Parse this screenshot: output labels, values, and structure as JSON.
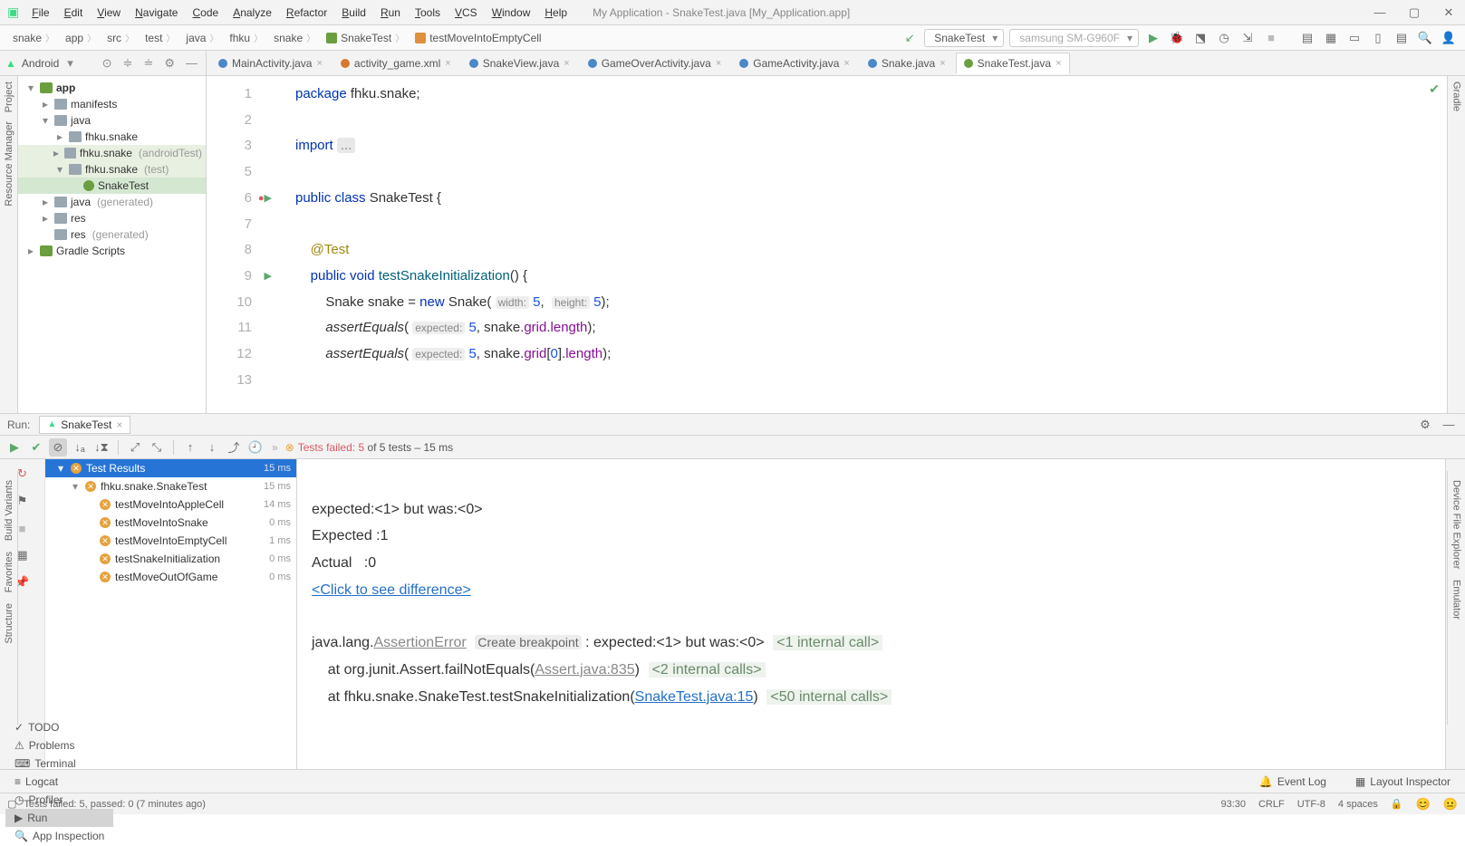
{
  "window": {
    "menu": [
      "File",
      "Edit",
      "View",
      "Navigate",
      "Code",
      "Analyze",
      "Refactor",
      "Build",
      "Run",
      "Tools",
      "VCS",
      "Window",
      "Help"
    ],
    "title": "My Application - SnakeTest.java [My_Application.app]"
  },
  "breadcrumb": [
    "snake",
    "app",
    "src",
    "test",
    "java",
    "fhku",
    "snake",
    "SnakeTest",
    "testMoveIntoEmptyCell"
  ],
  "toolbar": {
    "config": "SnakeTest",
    "device": "samsung SM-G960F"
  },
  "project": {
    "view_label": "Android",
    "tree": [
      {
        "d": 0,
        "arr": "▾",
        "ico": "mod",
        "txt": "app",
        "bold": true
      },
      {
        "d": 1,
        "arr": "▸",
        "ico": "fldr",
        "txt": "manifests"
      },
      {
        "d": 1,
        "arr": "▾",
        "ico": "fldr",
        "txt": "java"
      },
      {
        "d": 2,
        "arr": "▸",
        "ico": "pkg",
        "txt": "fhku.snake"
      },
      {
        "d": 2,
        "arr": "▸",
        "ico": "pkg",
        "txt": "fhku.snake",
        "note": "(androidTest)",
        "hi": true
      },
      {
        "d": 2,
        "arr": "▾",
        "ico": "pkg",
        "txt": "fhku.snake",
        "note": "(test)",
        "hi": true
      },
      {
        "d": 3,
        "arr": "",
        "ico": "cls",
        "txt": "SnakeTest",
        "sel": true
      },
      {
        "d": 1,
        "arr": "▸",
        "ico": "fldr",
        "txt": "java",
        "note": "(generated)"
      },
      {
        "d": 1,
        "arr": "▸",
        "ico": "fldr",
        "txt": "res"
      },
      {
        "d": 1,
        "arr": "",
        "ico": "fldr",
        "txt": "res",
        "note": "(generated)"
      },
      {
        "d": 0,
        "arr": "▸",
        "ico": "mod",
        "txt": "Gradle Scripts"
      }
    ]
  },
  "tabs": [
    {
      "name": "MainActivity.java",
      "ico": "c"
    },
    {
      "name": "activity_game.xml",
      "ico": "x"
    },
    {
      "name": "SnakeView.java",
      "ico": "c"
    },
    {
      "name": "GameOverActivity.java",
      "ico": "c"
    },
    {
      "name": "GameActivity.java",
      "ico": "c"
    },
    {
      "name": "Snake.java",
      "ico": "c"
    },
    {
      "name": "SnakeTest.java",
      "ico": "g",
      "active": true
    }
  ],
  "editor": {
    "lines": [
      "<span class='kw'>package</span> fhku.snake;",
      "",
      "<span class='kw'>import</span> <span class='fold'>...</span>",
      "",
      "<span class='kw'>public class</span> SnakeTest {",
      "",
      "    <span class='ann'>@Test</span>",
      "    <span class='kw'>public void</span> <span style='color:#00627a'>testSnakeInitialization</span>() {",
      "        Snake snake = <span class='kw'>new</span> Snake( <span class='hint'>width:</span> <span class='num'>5</span>,  <span class='hint'>height:</span> <span class='num'>5</span>);",
      "        <span class='fn'>assertEquals</span>( <span class='hint'>expected:</span> <span class='num'>5</span>, snake.<span class='fld'>grid</span>.<span class='fld'>length</span>);",
      "        <span class='fn'>assertEquals</span>( <span class='hint'>expected:</span> <span class='num'>5</span>, snake.<span class='fld'>grid</span>[<span class='num'>0</span>].<span class='fld'>length</span>);",
      ""
    ],
    "nums": [
      "1",
      "2",
      "3",
      "5",
      "6",
      "7",
      "8",
      "9",
      "10",
      "11",
      "12",
      "13"
    ],
    "gutter_marks": {
      "4": "rund",
      "7": "run"
    }
  },
  "run": {
    "label": "Run:",
    "tab": "SnakeTest",
    "summary_pre": "Tests failed: 5",
    "summary_post": " of 5 tests – 15 ms",
    "tree": [
      {
        "d": 0,
        "arr": "▾",
        "nm": "Test Results",
        "tm": "15 ms",
        "sel": true
      },
      {
        "d": 1,
        "arr": "▾",
        "nm": "fhku.snake.SnakeTest",
        "tm": "15 ms"
      },
      {
        "d": 2,
        "arr": "",
        "nm": "testMoveIntoAppleCell",
        "tm": "14 ms"
      },
      {
        "d": 2,
        "arr": "",
        "nm": "testMoveIntoSnake",
        "tm": "0 ms"
      },
      {
        "d": 2,
        "arr": "",
        "nm": "testMoveIntoEmptyCell",
        "tm": "1 ms"
      },
      {
        "d": 2,
        "arr": "",
        "nm": "testSnakeInitialization",
        "tm": "0 ms"
      },
      {
        "d": 2,
        "arr": "",
        "nm": "testMoveOutOfGame",
        "tm": "0 ms"
      }
    ],
    "console": {
      "l1": "expected:<1> but was:<0>",
      "l2": "Expected :1",
      "l3": "Actual   :0",
      "diff": "<Click to see difference>",
      "err1a": "java.lang.",
      "err1b": "AssertionError",
      "bp": "Create breakpoint",
      "err1c": " : expected:<1> but was:<0>",
      "c1": "<1 internal call>",
      "err2a": "    at org.junit.Assert.failNotEquals(",
      "err2b": "Assert.java:835",
      "err2c": ")",
      "c2": "<2 internal calls>",
      "err3a": "    at fhku.snake.SnakeTest.testSnakeInitialization(",
      "err3b": "SnakeTest.java:15",
      "err3c": ")",
      "c3": "<50 internal calls>"
    }
  },
  "bottom_tabs": [
    "TODO",
    "Problems",
    "Terminal",
    "Logcat",
    "Profiler",
    "Run",
    "App Inspection"
  ],
  "bottom_right": [
    "Event Log",
    "Layout Inspector"
  ],
  "status": {
    "msg": "Tests failed: 5, passed: 0 (7 minutes ago)",
    "pos": "93:30",
    "eol": "CRLF",
    "enc": "UTF-8",
    "indent": "4 spaces"
  },
  "rails": {
    "left": [
      "Project",
      "Resource Manager"
    ],
    "left2": [
      "Build Variants",
      "Favorites",
      "Structure"
    ],
    "right": [
      "Gradle"
    ],
    "right2": [
      "Emulator",
      "Device File Explorer"
    ]
  }
}
